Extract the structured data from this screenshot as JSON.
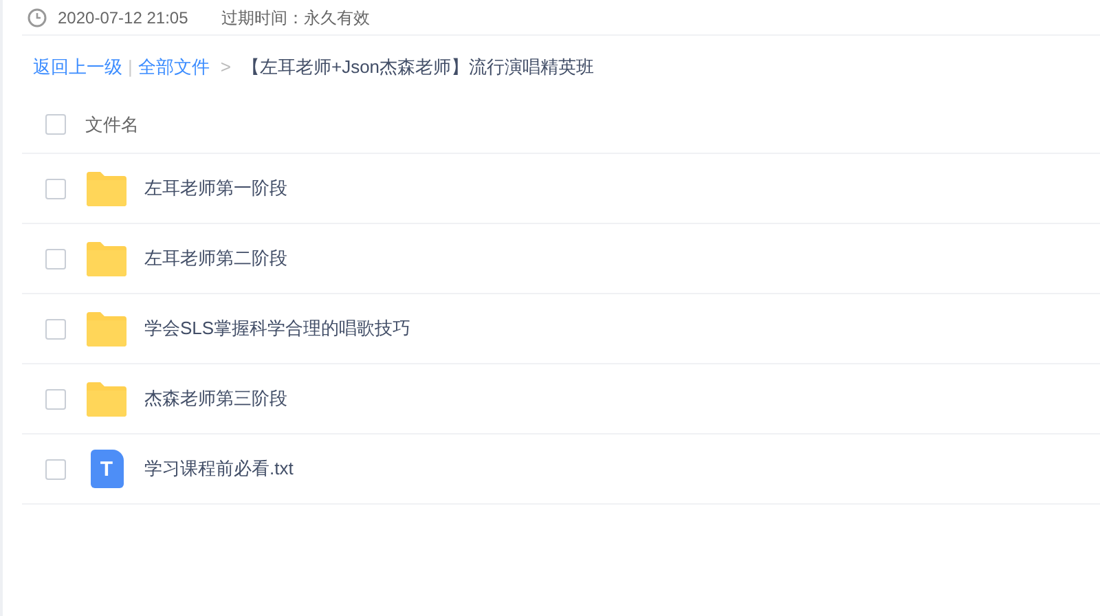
{
  "share_info": {
    "time": "2020-07-12 21:05",
    "expiry": "过期时间：永久有效"
  },
  "breadcrumb": {
    "back": "返回上一级",
    "separator": "|",
    "root": "全部文件",
    "arrow": ">",
    "current": "【左耳老师+Json杰森老师】流行演唱精英班"
  },
  "header": {
    "checked": false,
    "label": "文件名"
  },
  "files": [
    {
      "kind": "folder",
      "name": "左耳老师第一阶段",
      "checked": false
    },
    {
      "kind": "folder",
      "name": "左耳老师第二阶段",
      "checked": false
    },
    {
      "kind": "folder",
      "name": "学会SLS掌握科学合理的唱歌技巧",
      "checked": false
    },
    {
      "kind": "folder",
      "name": "杰森老师第三阶段",
      "checked": false
    },
    {
      "kind": "text",
      "name": "学习课程前必看.txt",
      "checked": false,
      "icon_letter": "T"
    }
  ]
}
